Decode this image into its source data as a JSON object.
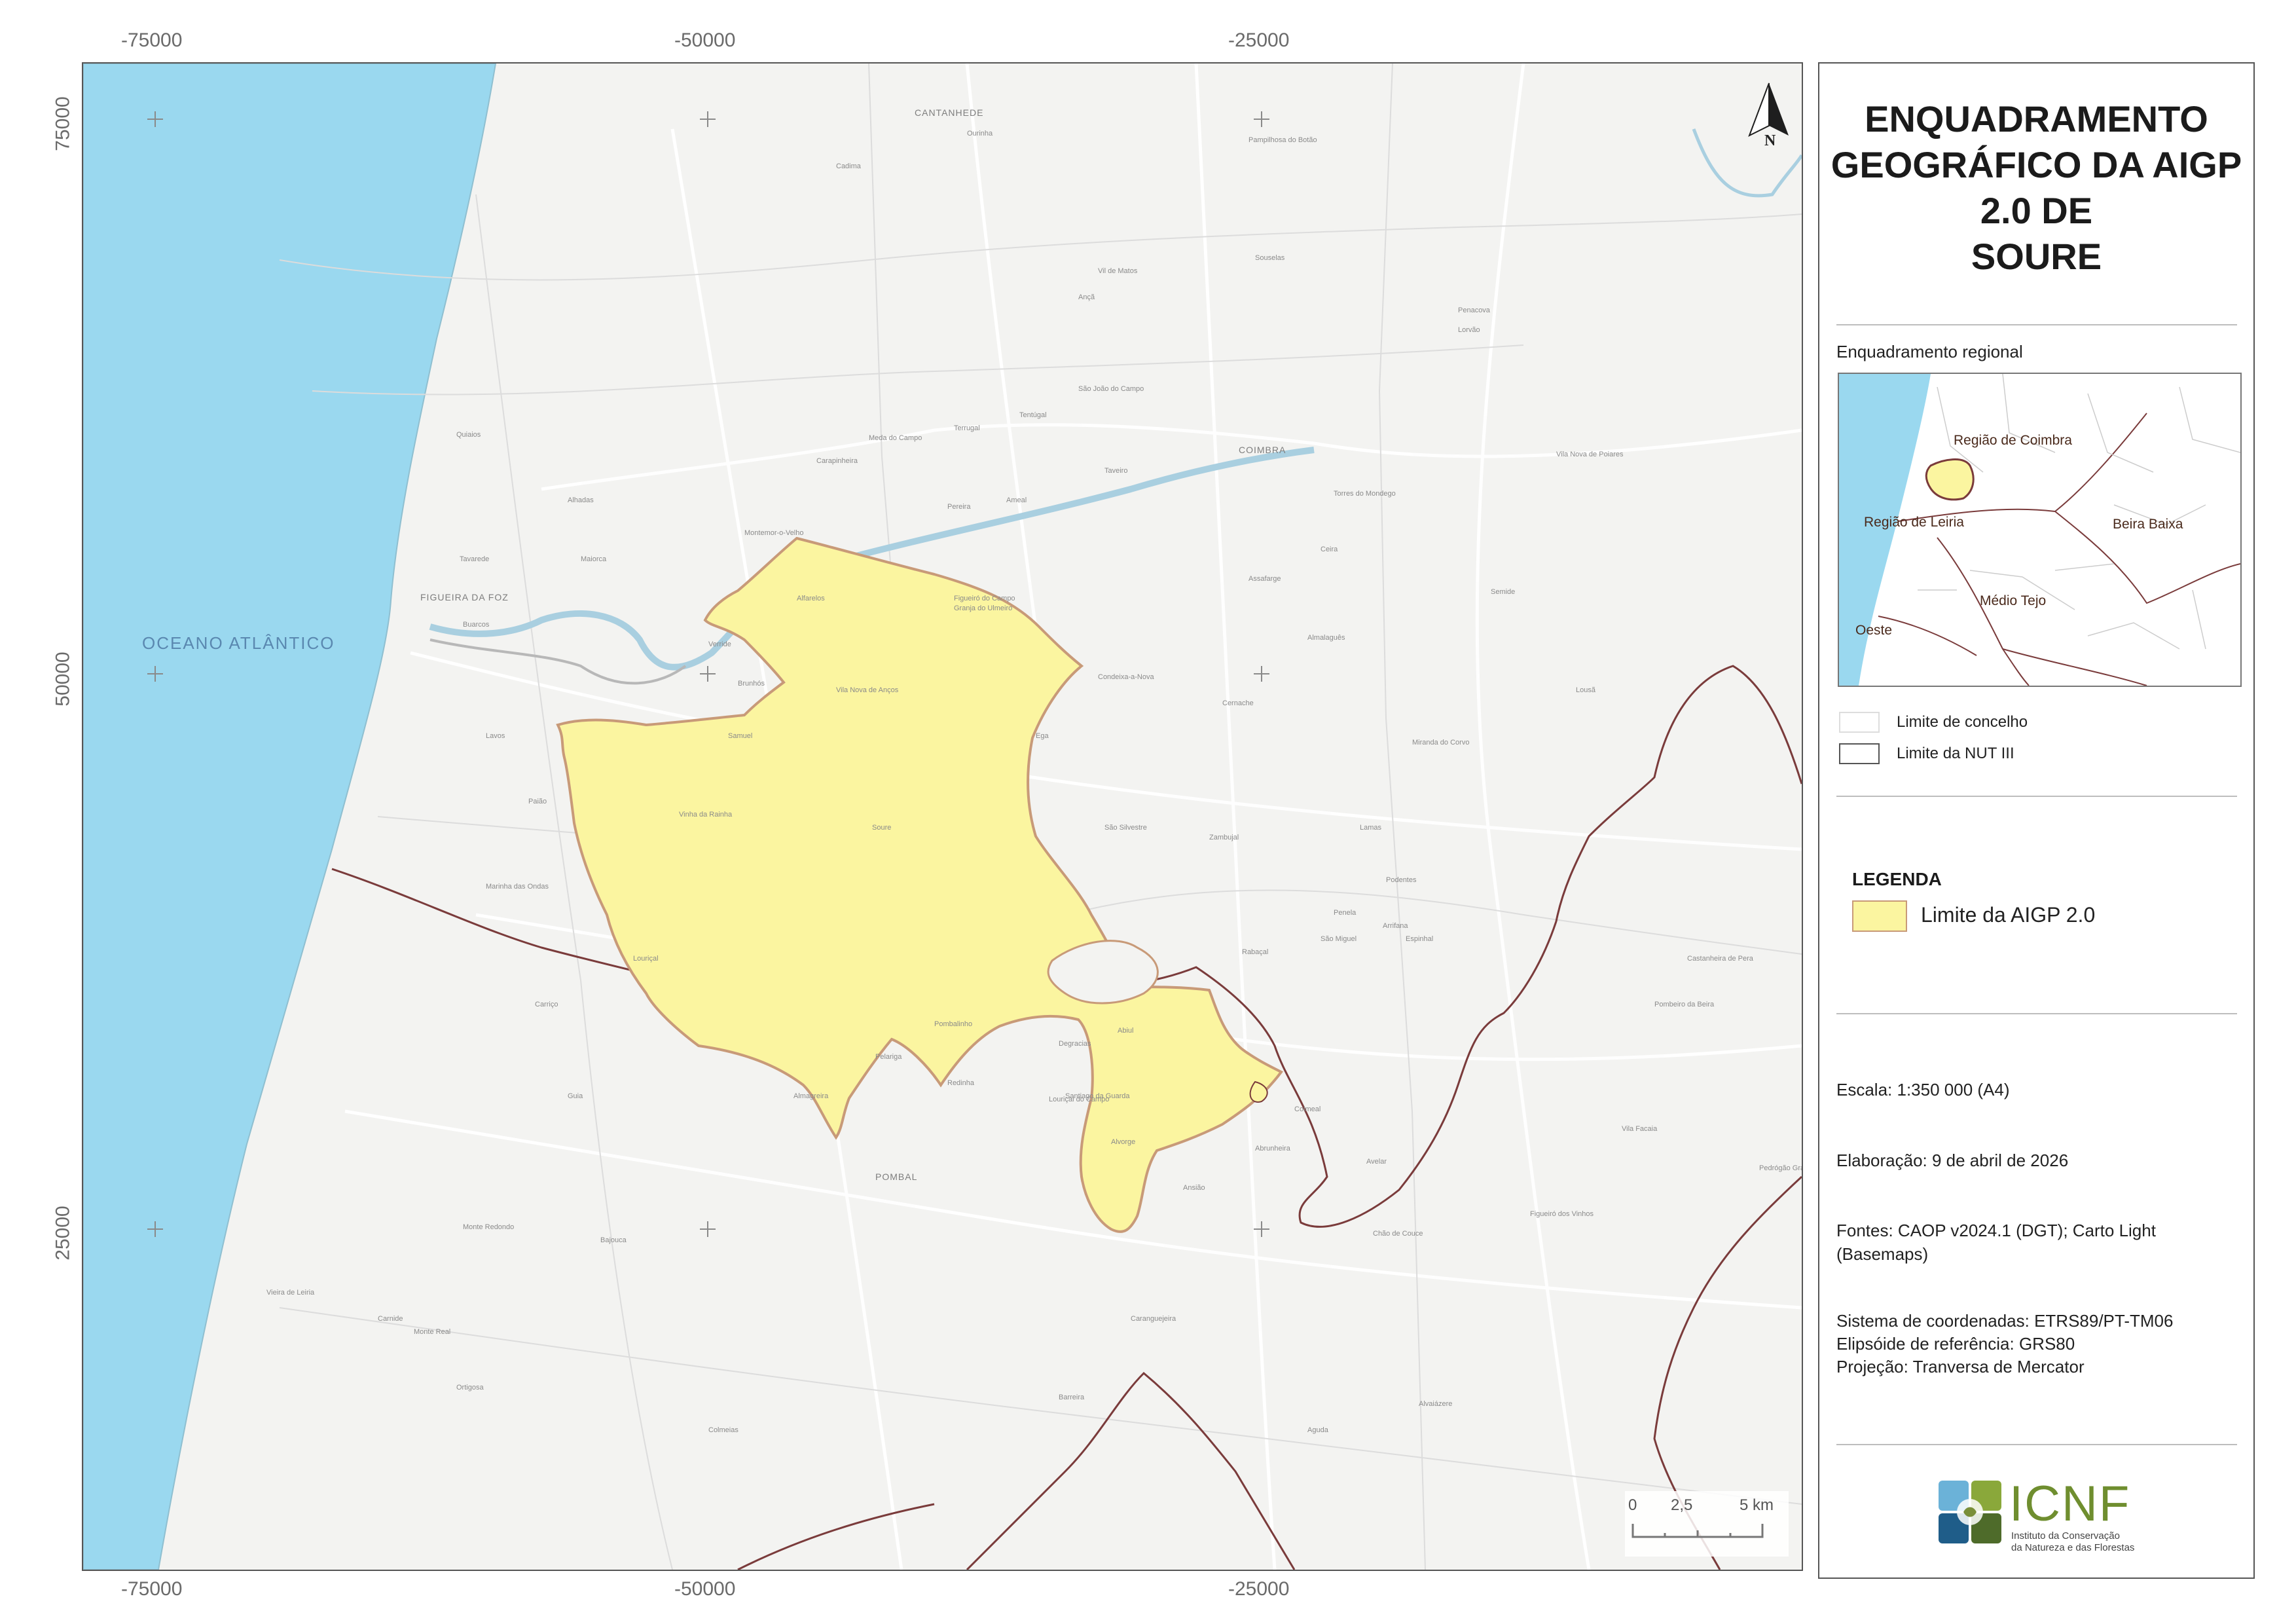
{
  "axis": {
    "top": [
      "-75000",
      "-50000",
      "-25000"
    ],
    "bottom": [
      "-75000",
      "-50000",
      "-25000"
    ],
    "left": [
      "75000",
      "50000",
      "25000"
    ]
  },
  "map": {
    "ocean_label": "OCEANO ATLÂNTICO",
    "north_letter": "N",
    "places_major": [
      "CANTANHEDE",
      "COIMBRA",
      "FIGUEIRA DA FOZ",
      "POMBAL"
    ],
    "places_minor": [
      "Cadima",
      "Ourinha",
      "Pampilhosa do Botão",
      "Vil de Matos",
      "Souselas",
      "Ançã",
      "São João do Campo",
      "Terrugal",
      "Carapinheira",
      "Meda do Campo",
      "Tentúgal",
      "Taveiro",
      "Ameal",
      "Pereira",
      "Montemor-o-Velho",
      "Verride",
      "Alfarelos",
      "Figueiró do Campo",
      "Granja do Ulmeiro",
      "Vila Nova de Anços",
      "Brunhós",
      "Samuel",
      "Soure",
      "Vinha da Rainha",
      "Degracias",
      "Pombalinho",
      "Redinha",
      "Almagreira",
      "Pelariga",
      "Condeixa-a-Nova",
      "Ega",
      "Zambujal",
      "Penela",
      "Espinhal",
      "Miranda do Corvo",
      "Lousã",
      "Vila Nova de Poiares",
      "Penacova",
      "Lorvão",
      "Torres do Mondego",
      "Ceira",
      "Semide",
      "Assafarge",
      "Almalaguês",
      "Cernache",
      "Tavarede",
      "Maiorca",
      "Alhadas",
      "Quiaios",
      "Buarcos",
      "Lavos",
      "Paião",
      "Marinha das Ondas",
      "Louriçal",
      "Carriço",
      "Guia",
      "Vieira de Leiria",
      "Monte Redondo",
      "Bajouca",
      "Carnide",
      "Monte Real",
      "Ortigosa",
      "Colmeias",
      "Barreira",
      "Caranguejeira",
      "Alvaiázere",
      "Ansião",
      "Avelar",
      "Chão de Couce",
      "Castanheira de Pera",
      "Pedrógão Grande",
      "Figueiró dos Vinhos",
      "Vila Facaia",
      "Aguda",
      "Abiul",
      "Santiago da Guarda",
      "Louriçal do Campo",
      "Arrifana",
      "Colmeal",
      "Abrunheira",
      "São Silvestre",
      "Lamas",
      "Podentes",
      "Rabaçal",
      "Alvorge",
      "São Miguel",
      "Pombeiro da Beira"
    ]
  },
  "scalebar": {
    "labels": [
      "0",
      "2,5",
      "5 km"
    ]
  },
  "panel": {
    "title_lines": [
      "ENQUADRAMENTO",
      "GEOGRÁFICO DA AIGP",
      "2.0 DE",
      "SOURE"
    ],
    "inset_title": "Enquadramento regional",
    "inset_labels": {
      "coimbra": "Região de Coimbra",
      "leiria": "Região de Leiria",
      "beira": "Beira Baixa",
      "tejo": "Médio Tejo",
      "oeste": "Oeste"
    },
    "limit_legend": [
      "Limite de concelho",
      "Limite da NUT III"
    ],
    "legend_title": "LEGENDA",
    "legend_item": "Limite da AIGP 2.0",
    "info": [
      "Escala: 1:350 000 (A4)",
      "Elaboração: 9 de abril de 2026",
      "Fontes: CAOP v2024.1 (DGT); Carto Light",
      "(Basemaps)",
      "Sistema de coordenadas: ETRS89/PT-TM06",
      "Elipsóide de referência: GRS80",
      "Projeção: Tranversa de Mercator"
    ],
    "logo_name": "ICNF",
    "logo_sub1": "Instituto da Conservação",
    "logo_sub2": "da Natureza e das Florestas"
  },
  "colors": {
    "ocean": "#9ad8ef",
    "aigp_fill": "#fbf5a0",
    "aigp_stroke": "#c89a78",
    "nut_boundary": "#7a3b3b",
    "land": "#f3f3f1"
  }
}
